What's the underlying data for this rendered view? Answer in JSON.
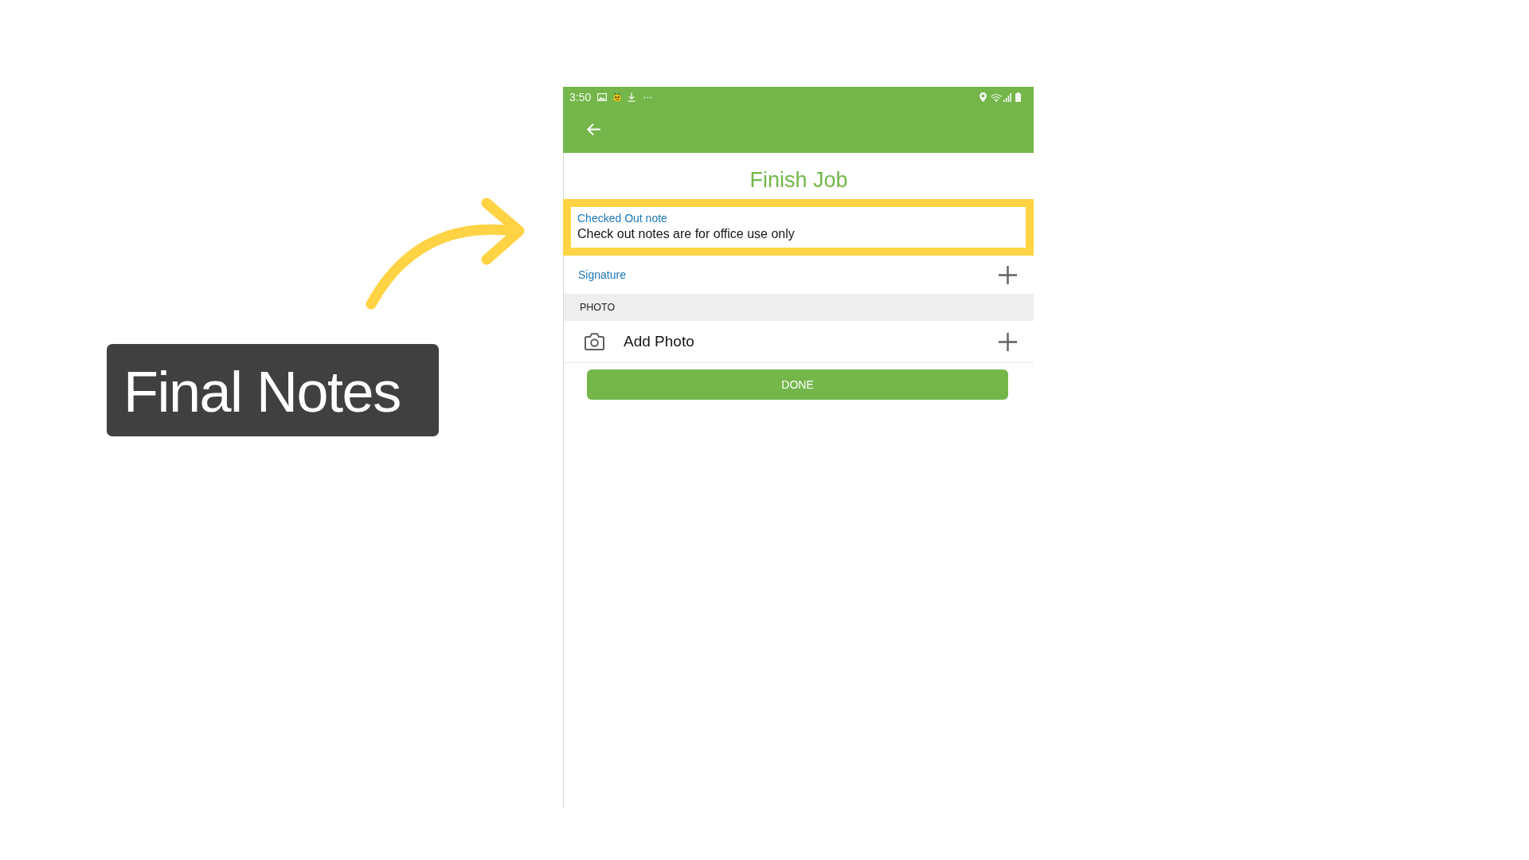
{
  "annotation": {
    "label": "Final Notes"
  },
  "status_bar": {
    "time": "3:50"
  },
  "screen": {
    "title": "Finish Job"
  },
  "note_field": {
    "label": "Checked Out note",
    "value": "Check out notes are for office use only",
    "highlighted": true
  },
  "signature": {
    "label": "Signature"
  },
  "photo_section": {
    "header": "PHOTO",
    "add_label": "Add Photo"
  },
  "done_button": {
    "label": "DONE"
  }
}
